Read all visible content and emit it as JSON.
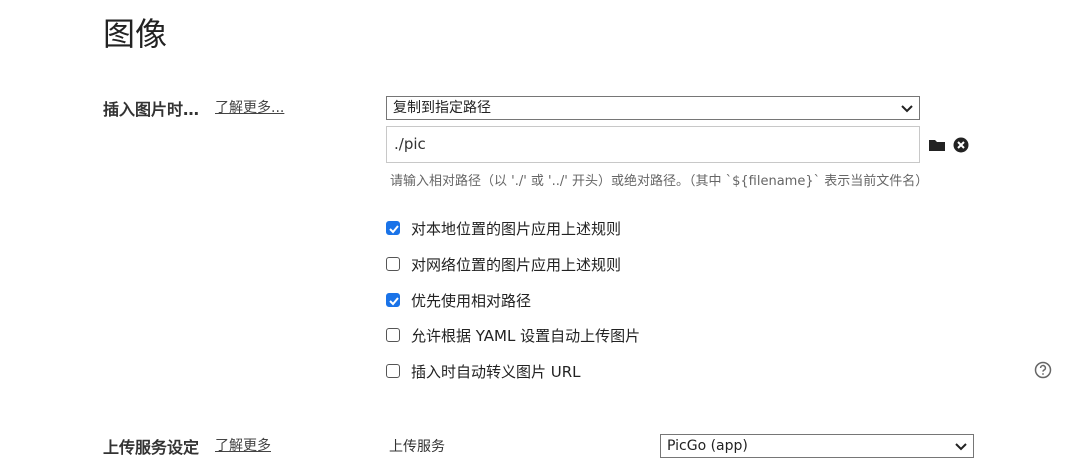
{
  "page_title": "图像",
  "image_section": {
    "label": "插入图片时…",
    "learn_more": "了解更多...",
    "insert_action": "复制到指定路径",
    "path_value": "./pic",
    "hint": "请输入相对路径（以 './' 或 '../' 开头）或绝对路径。（其中 `${filename}` 表示当前文件名）",
    "options": [
      {
        "label": "对本地位置的图片应用上述规则",
        "checked": true
      },
      {
        "label": "对网络位置的图片应用上述规则",
        "checked": false
      },
      {
        "label": "优先使用相对路径",
        "checked": true
      },
      {
        "label": "允许根据 YAML 设置自动上传图片",
        "checked": false
      },
      {
        "label": "插入时自动转义图片 URL",
        "checked": false
      }
    ]
  },
  "upload_section": {
    "label": "上传服务设定",
    "learn_more": "了解更多",
    "service_label": "上传服务",
    "service_value": "PicGo (app)"
  },
  "icons": {
    "folder": "folder-icon",
    "clear": "clear-icon",
    "help": "help-icon",
    "chevron": "chevron-down-icon"
  },
  "colors": {
    "checkbox_checked": "#1a73e8",
    "text": "#333333"
  }
}
